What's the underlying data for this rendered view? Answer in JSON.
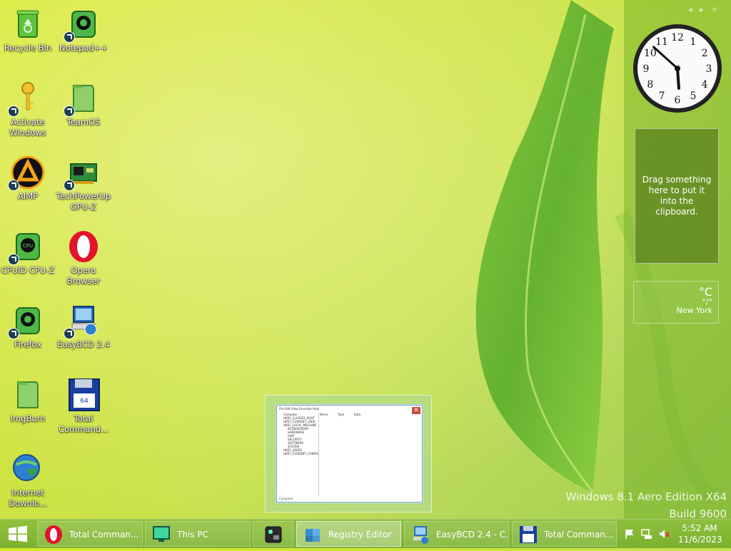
{
  "desktop": {
    "icons": [
      {
        "label": "Recycle Bin",
        "icon": "recycle-bin-icon"
      },
      {
        "label": "Notepad++",
        "icon": "notepad-icon"
      },
      {
        "label": "Activate Windows",
        "icon": "key-icon"
      },
      {
        "label": "TeamOS",
        "icon": "folder-icon"
      },
      {
        "label": "AIMP",
        "icon": "aimp-icon"
      },
      {
        "label": "TechPowerUp GPU-Z",
        "icon": "gpu-z-icon"
      },
      {
        "label": "CPUID CPU-Z",
        "icon": "cpu-z-icon"
      },
      {
        "label": "Opera Browser",
        "icon": "opera-icon"
      },
      {
        "label": "Firefox",
        "icon": "firefox-icon"
      },
      {
        "label": "EasyBCD 2.4",
        "icon": "easybcd-icon"
      },
      {
        "label": "ImgBurn",
        "icon": "imgburn-icon"
      },
      {
        "label": "Total Command...",
        "icon": "floppy-icon"
      },
      {
        "label": "Internet Downlo...",
        "icon": "idm-icon"
      }
    ]
  },
  "gadgets": {
    "clock": {
      "hour": 5,
      "minute": 52
    },
    "clipboard": {
      "text": "Drag something here to put it into the clipboard."
    },
    "weather": {
      "temp": "°C",
      "range": "°/°",
      "city": "New York"
    }
  },
  "watermark": {
    "line1": "Windows 8.1 Aero Edition X64",
    "line2": "Build 9600"
  },
  "preview": {
    "menu": "File  Edit  View  Favorites  Help",
    "tree": [
      "Computer",
      "HKEY_CLASSES_ROOT",
      "HKEY_CURRENT_USER",
      "HKEY_LOCAL_MACHINE",
      "BCD00000000",
      "HARDWARE",
      "SAM",
      "SECURITY",
      "SOFTWARE",
      "SYSTEM",
      "HKEY_USERS",
      "HKEY_CURRENT_CONFIG"
    ],
    "columns": "Name Type Data",
    "status": "Computer"
  },
  "taskbar": {
    "items": [
      {
        "label": "Total Comman...",
        "icon": "opera-icon"
      },
      {
        "label": "This PC",
        "icon": "monitor-icon"
      },
      {
        "label": "",
        "icon": "app-icon"
      },
      {
        "label": "Registry Editor",
        "icon": "registry-icon"
      },
      {
        "label": "EasyBCD 2.4 - C...",
        "icon": "easybcd-icon"
      },
      {
        "label": "Total Comman...",
        "icon": "floppy-icon"
      }
    ],
    "time": "5:52 AM",
    "date": "11/6/2023"
  }
}
